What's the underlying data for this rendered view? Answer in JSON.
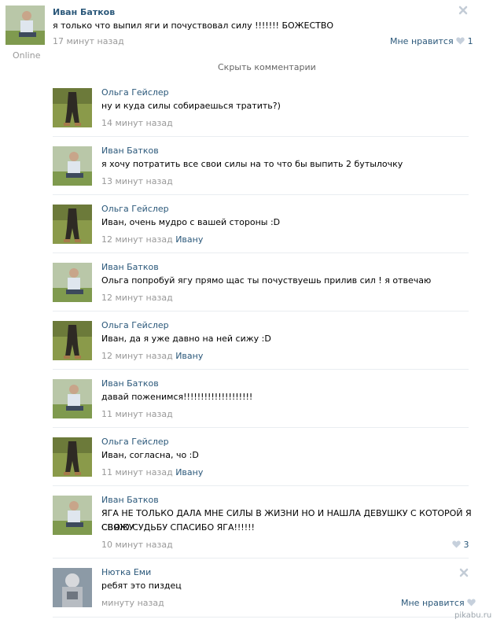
{
  "post": {
    "author": "Иван Батков",
    "text": "я только что выпил яги и почуствовал силу !!!!!!! БОЖЕСТВО",
    "time": "17 минут назад",
    "status": "Online",
    "like_label": "Мне нравится",
    "like_count": "1"
  },
  "hide_comments_label": "Скрыть комментарии",
  "comments": [
    {
      "author": "Ольга Гейслер",
      "text": "ну и куда силы собираешься тратить?)",
      "time": "14 минут назад",
      "reply_to": ""
    },
    {
      "author": "Иван Батков",
      "text": "я хочу потратить все свои силы на то что бы выпить 2 бутылочку",
      "time": "13 минут назад",
      "reply_to": ""
    },
    {
      "author": "Ольга Гейслер",
      "text": "Иван, очень мудро с вашей стороны :D",
      "time": "12 минут назад",
      "reply_to": "Ивану"
    },
    {
      "author": "Иван Батков",
      "text": "Ольга попробуй ягу прямо щас ты почуствуешь прилив сил ! я отвечаю",
      "time": "12 минут назад",
      "reply_to": ""
    },
    {
      "author": "Ольга Гейслер",
      "text": "Иван, да я уже давно на ней сижу :D",
      "time": "12 минут назад",
      "reply_to": "Ивану"
    },
    {
      "author": "Иван Батков",
      "text": "давай поженимся!!!!!!!!!!!!!!!!!!!!",
      "time": "11 минут назад",
      "reply_to": ""
    },
    {
      "author": "Ольга Гейслер",
      "text": "Иван, согласна, чо :D",
      "time": "11 минут назад",
      "reply_to": "Ивану"
    },
    {
      "author": "Иван Батков",
      "text_line1": "ЯГА НЕ ТОЛЬКО ДАЛА МНЕ СИЛЫ В ЖИЗНИ НО И НАШЛА ДЕВУШКУ С КОТОРОЙ Я СВЯЖУ",
      "text_line2": "СВОЮ СУДЬБУ СПАСИБО ЯГА!!!!!!",
      "time": "10 минут назад",
      "like_count": "3"
    },
    {
      "author": "Нютка Еми",
      "text": "ребят это пиздец",
      "time": "минуту назад",
      "like_label": "Мне нравится"
    }
  ],
  "watermark": "pikabu.ru",
  "colors": {
    "link": "#2b587a",
    "meta": "#999999",
    "separator": "#e9edf1",
    "heart": "#c6d0dc"
  },
  "icons": {
    "close": "close-icon",
    "like": "heart-icon"
  }
}
